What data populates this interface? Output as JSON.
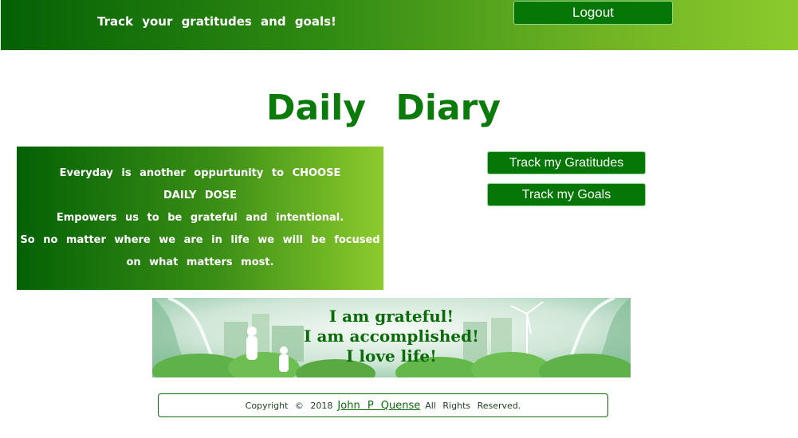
{
  "header": {
    "tagline": "Track your gratitudes and goals!",
    "logout_label": "Logout"
  },
  "main": {
    "title": "Daily Diary",
    "quote_lines": [
      "Everyday is another oppurtunity to CHOOSE",
      "DAILY DOSE",
      "Empowers us to be grateful and intentional.",
      "So no matter where we are in life we will be focused",
      "on what matters most."
    ],
    "buttons": {
      "gratitudes": "Track my Gratitudes",
      "goals": "Track my Goals"
    },
    "banner_lines": [
      "I am grateful!",
      "I am accomplished!",
      "I love life!"
    ]
  },
  "footer": {
    "copyright_prefix": "Copyright © 2018",
    "author": "John P Quense",
    "rights": "All Rights Reserved."
  },
  "colors": {
    "primary_green": "#067706",
    "gradient_start": "#046104",
    "gradient_end": "#8ccb2c"
  }
}
